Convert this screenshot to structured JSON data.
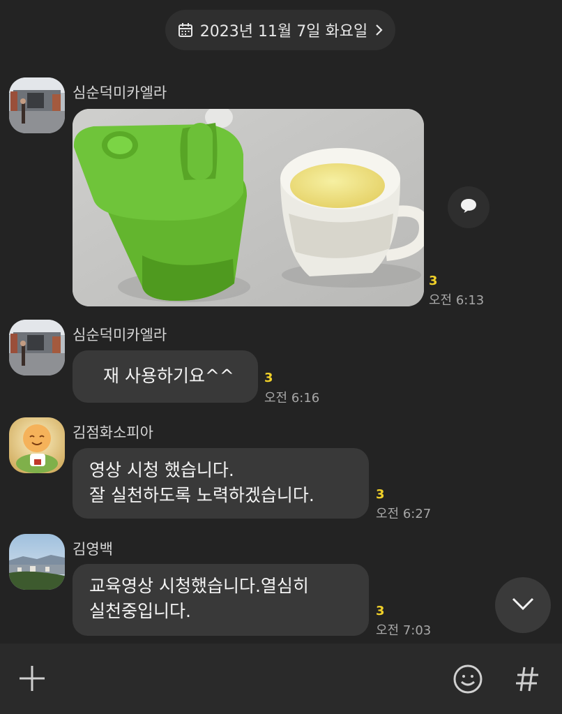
{
  "date_header": {
    "label": "2023년 11월 7일 화요일",
    "calendar_icon": "calendar-icon",
    "arrow_icon": "chevron-right-icon"
  },
  "messages": [
    {
      "sender": "심순덕미카엘라",
      "type": "image",
      "unread": "3",
      "time": "오전 6:13"
    },
    {
      "sender": "심순덕미카엘라",
      "type": "text",
      "text": "재 사용하기요^^",
      "unread": "3",
      "time": "오전 6:16"
    },
    {
      "sender": "김점화소피아",
      "type": "text",
      "text": "영상 시청 했습니다.\n잘 실천하도록 노력하겠습니다.",
      "unread": "3",
      "time": "오전 6:27"
    },
    {
      "sender": "김영백",
      "type": "text",
      "text": "교육영상 시청했습니다.열심히\n실천중입니다.",
      "unread": "3",
      "time": "오전 7:03"
    }
  ],
  "icons": {
    "share": "speech-bubble-icon",
    "scroll_down": "chevron-down-icon",
    "add": "plus-icon",
    "emoji": "smiley-icon",
    "hashtag": "hashtag-icon"
  },
  "colors": {
    "background": "#232323",
    "bubble": "#393939",
    "unread": "#f0d029",
    "time": "#a8a8a8"
  }
}
